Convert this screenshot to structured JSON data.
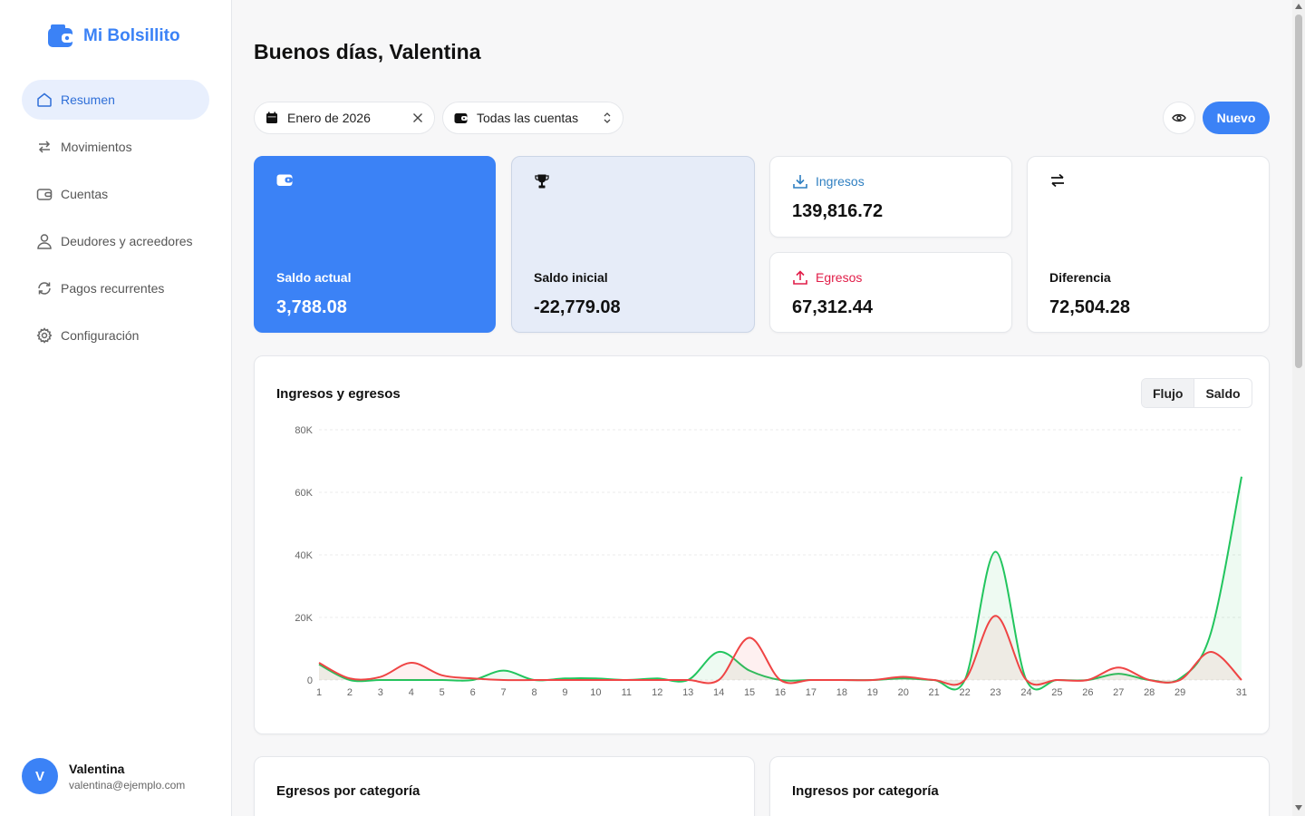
{
  "app": {
    "name": "Mi Bolsillito",
    "brand_color": "#3b82f6"
  },
  "sidebar": {
    "items": [
      {
        "label": "Resumen",
        "icon": "home-icon",
        "active": true
      },
      {
        "label": "Movimientos",
        "icon": "arrows-icon"
      },
      {
        "label": "Cuentas",
        "icon": "wallet-icon"
      },
      {
        "label": "Deudores y acreedores",
        "icon": "user-icon"
      },
      {
        "label": "Pagos recurrentes",
        "icon": "refresh-icon"
      },
      {
        "label": "Configuración",
        "icon": "gear-icon"
      }
    ]
  },
  "user": {
    "initial": "V",
    "name": "Valentina",
    "email": "valentina@ejemplo.com"
  },
  "header": {
    "greeting": "Buenos días, Valentina"
  },
  "filters": {
    "period": "Enero de 2026",
    "account": "Todas las cuentas",
    "new_label": "Nuevo"
  },
  "stats": {
    "saldo_actual": {
      "label": "Saldo actual",
      "value": "3,788.08"
    },
    "saldo_inicial": {
      "label": "Saldo inicial",
      "value": "-22,779.08"
    },
    "ingresos": {
      "label": "Ingresos",
      "value": "139,816.72",
      "color": "#2f7fc1"
    },
    "egresos": {
      "label": "Egresos",
      "value": "67,312.44",
      "color": "#e11d48"
    },
    "diferencia": {
      "label": "Diferencia",
      "value": "72,504.28"
    }
  },
  "chart": {
    "title": "Ingresos y egresos",
    "toggle": [
      "Flujo",
      "Saldo"
    ],
    "active_toggle": "Flujo"
  },
  "chart_data": {
    "type": "area",
    "x_ticks": [
      1,
      2,
      3,
      4,
      5,
      6,
      7,
      8,
      9,
      10,
      11,
      12,
      13,
      14,
      15,
      16,
      17,
      18,
      19,
      20,
      21,
      22,
      23,
      24,
      25,
      26,
      27,
      28,
      29,
      31
    ],
    "y_ticks": [
      "0",
      "20K",
      "40K",
      "60K",
      "80K"
    ],
    "ylim": [
      0,
      80000
    ],
    "xlim": [
      1,
      31
    ],
    "grid": true,
    "series": [
      {
        "color": "#22c55e",
        "values": [
          5000,
          0,
          0,
          0,
          0,
          0,
          3000,
          0,
          500,
          500,
          0,
          500,
          0,
          9000,
          3000,
          0,
          0,
          0,
          0,
          500,
          0,
          0,
          41000,
          0,
          0,
          0,
          2000,
          0,
          500,
          15000,
          65000
        ]
      },
      {
        "color": "#ef4444",
        "values": [
          5500,
          500,
          1000,
          5500,
          1500,
          500,
          0,
          0,
          0,
          0,
          0,
          0,
          0,
          0,
          13500,
          0,
          0,
          0,
          0,
          1000,
          0,
          0,
          20500,
          0,
          0,
          0,
          4000,
          0,
          0,
          9000,
          0
        ]
      }
    ]
  },
  "bottom": {
    "left_title": "Egresos por categoría",
    "right_title": "Ingresos por categoría"
  }
}
